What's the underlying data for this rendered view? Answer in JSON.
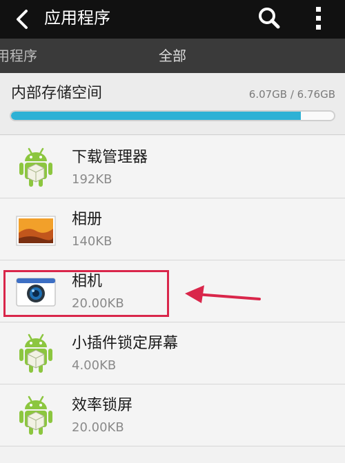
{
  "header": {
    "title": "应用程序",
    "back_icon": "back-arrow-icon",
    "search_icon": "search-icon",
    "overflow_icon": "overflow-menu-icon"
  },
  "tabs": [
    {
      "label": "用程序"
    },
    {
      "label": "全部"
    }
  ],
  "storage": {
    "title": "内部存储空间",
    "amount": "6.07GB / 6.76GB",
    "used_fraction": 0.898,
    "bar_color": "#2eb1d5"
  },
  "apps": [
    {
      "name": "下载管理器",
      "size": "192KB",
      "icon": "android-icon"
    },
    {
      "name": "相册",
      "size": "140KB",
      "icon": "gallery-icon"
    },
    {
      "name": "相机",
      "size": "20.00KB",
      "icon": "camera-icon"
    },
    {
      "name": "小插件锁定屏幕",
      "size": "4.00KB",
      "icon": "android-icon"
    },
    {
      "name": "效率锁屏",
      "size": "20.00KB",
      "icon": "android-icon"
    }
  ],
  "annotation_color": "#d9264a"
}
